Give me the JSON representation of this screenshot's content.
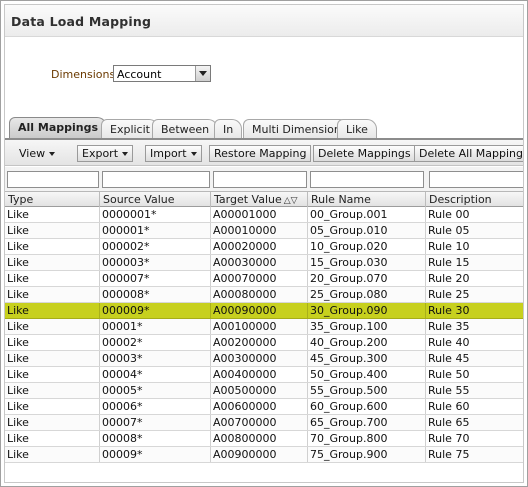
{
  "header": {
    "title": "Data Load Mapping"
  },
  "dimensions": {
    "label": "Dimensions",
    "selected": "Account"
  },
  "tabs": [
    {
      "label": "All Mappings",
      "active": true
    },
    {
      "label": "Explicit",
      "active": false
    },
    {
      "label": "Between",
      "active": false
    },
    {
      "label": "In",
      "active": false
    },
    {
      "label": "Multi Dimension",
      "active": false
    },
    {
      "label": "Like",
      "active": false
    }
  ],
  "toolbar": {
    "view_label": "View",
    "export_label": "Export",
    "import_label": "Import",
    "restore_label": "Restore Mapping",
    "delete_label": "Delete Mappings",
    "delete_all_label": "Delete All Mappings"
  },
  "table": {
    "columns": [
      "Type",
      "Source Value",
      "Target Value",
      "Rule Name",
      "Description"
    ],
    "sort_indicator": "△▽",
    "selected_row": 6,
    "rows": [
      [
        "Like",
        "0000001*",
        "A00001000",
        "00_Group.001",
        "Rule 00"
      ],
      [
        "Like",
        "000001*",
        "A00010000",
        "05_Group.010",
        "Rule 05"
      ],
      [
        "Like",
        "000002*",
        "A00020000",
        "10_Group.020",
        "Rule 10"
      ],
      [
        "Like",
        "000003*",
        "A00030000",
        "15_Group.030",
        "Rule 15"
      ],
      [
        "Like",
        "000007*",
        "A00070000",
        "20_Group.070",
        "Rule 20"
      ],
      [
        "Like",
        "000008*",
        "A00080000",
        "25_Group.080",
        "Rule 25"
      ],
      [
        "Like",
        "000009*",
        "A00090000",
        "30_Group.090",
        "Rule 30"
      ],
      [
        "Like",
        "00001*",
        "A00100000",
        "35_Group.100",
        "Rule 35"
      ],
      [
        "Like",
        "00002*",
        "A00200000",
        "40_Group.200",
        "Rule 40"
      ],
      [
        "Like",
        "00003*",
        "A00300000",
        "45_Group.300",
        "Rule 45"
      ],
      [
        "Like",
        "00004*",
        "A00400000",
        "50_Group.400",
        "Rule 50"
      ],
      [
        "Like",
        "00005*",
        "A00500000",
        "55_Group.500",
        "Rule 55"
      ],
      [
        "Like",
        "00006*",
        "A00600000",
        "60_Group.600",
        "Rule 60"
      ],
      [
        "Like",
        "00007*",
        "A00700000",
        "65_Group.700",
        "Rule 65"
      ],
      [
        "Like",
        "00008*",
        "A00800000",
        "70_Group.800",
        "Rule 70"
      ],
      [
        "Like",
        "00009*",
        "A00900000",
        "75_Group.900",
        "Rule 75"
      ]
    ]
  },
  "colors": {
    "selected_row": "#c7d01e",
    "dimension_label": "#6b3a00"
  }
}
